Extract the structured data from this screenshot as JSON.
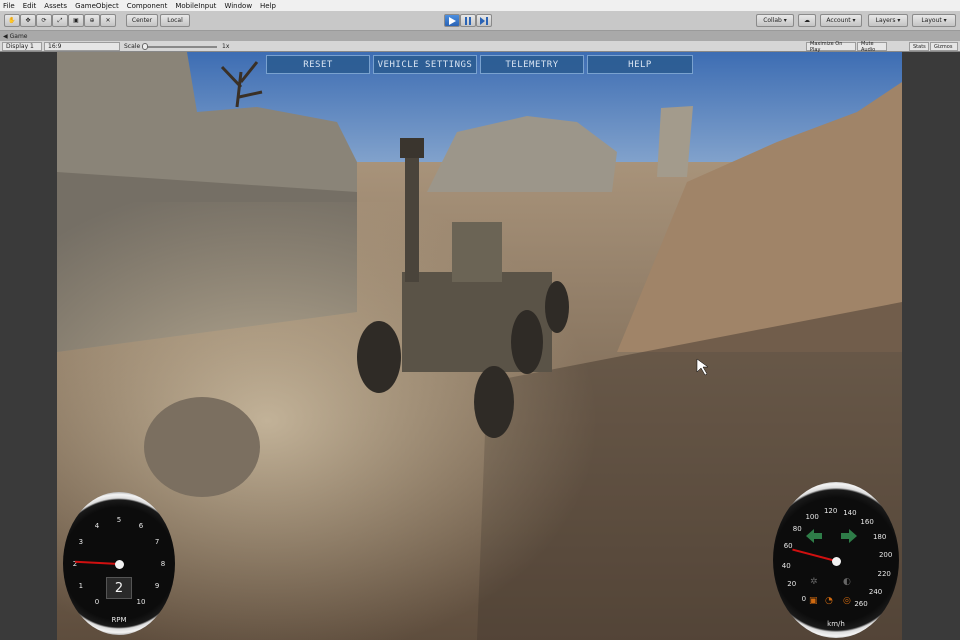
{
  "menu": [
    "File",
    "Edit",
    "Assets",
    "GameObject",
    "Component",
    "MobileInput",
    "Window",
    "Help"
  ],
  "toolbar": {
    "pivot_label": "Center",
    "space_label": "Local",
    "collab_label": "Collab ▾",
    "account_label": "Account ▾",
    "layers_label": "Layers",
    "layout_label": "Layout"
  },
  "tab": {
    "label": "Game"
  },
  "game_bar": {
    "display_label": "Display 1",
    "aspect_label": "16:9",
    "scale_label": "Scale",
    "scale_value": "1x",
    "maximize_label": "Maximize On Play",
    "mute_label": "Mute Audio",
    "stats_label": "Stats",
    "gizmos_label": "Gizmos"
  },
  "game_ui": {
    "reset_label": "RESET",
    "vehicle_settings_label": "VEHICLE SETTINGS",
    "telemetry_label": "TELEMETRY",
    "help_label": "HELP"
  },
  "rpm_gauge": {
    "label": "RPM",
    "gear": "2",
    "ticks": [
      "0",
      "1",
      "2",
      "3",
      "4",
      "5",
      "6",
      "7",
      "8",
      "9",
      "10"
    ],
    "needle_value": 2.1,
    "max": 10
  },
  "speed_gauge": {
    "label": "km/h",
    "ticks": [
      "0",
      "20",
      "40",
      "60",
      "80",
      "100",
      "120",
      "140",
      "160",
      "180",
      "200",
      "220",
      "240",
      "260"
    ],
    "needle_value": 58,
    "max": 260
  },
  "colors": {
    "ui_button": "#2c5d93",
    "needle": "#d01010",
    "arrow": "#2e7d48"
  }
}
